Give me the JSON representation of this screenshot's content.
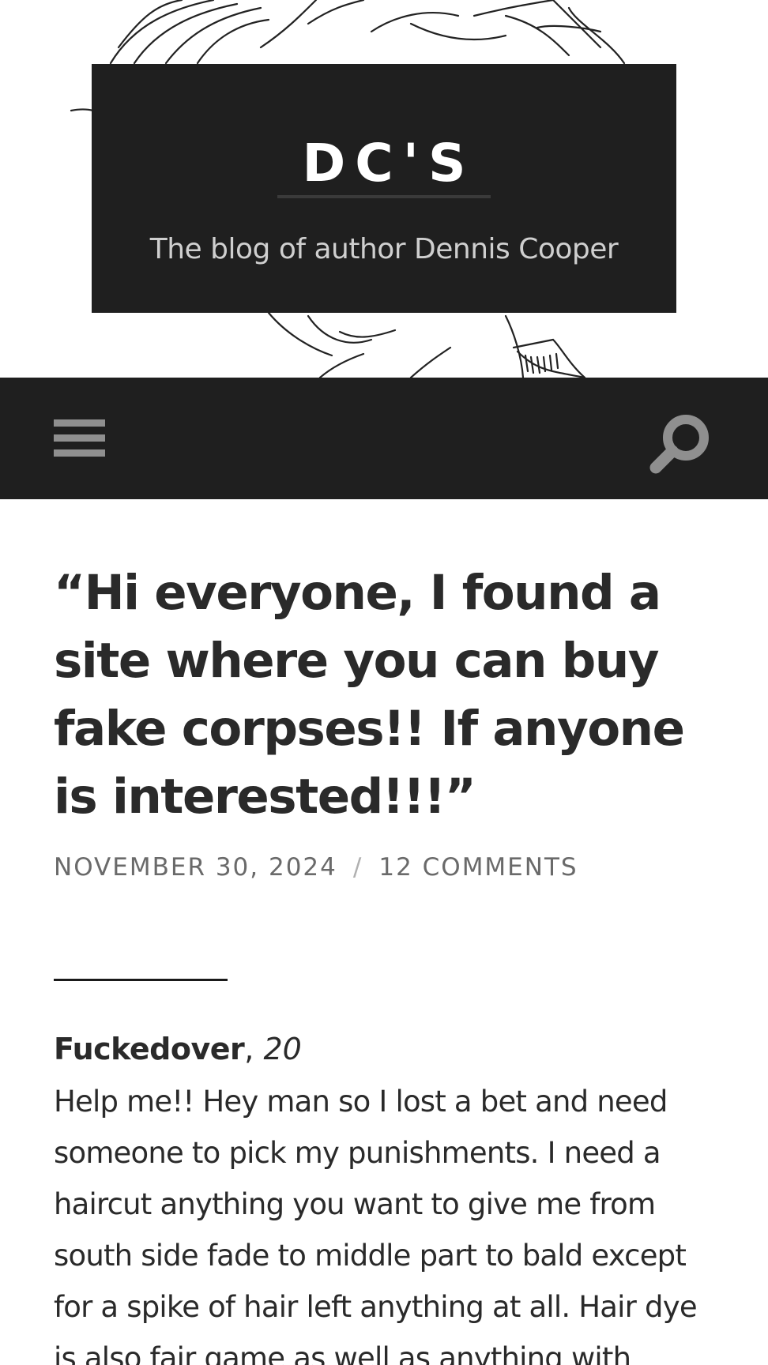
{
  "header": {
    "site_title": "DC'S",
    "tagline": "The blog of author Dennis Cooper"
  },
  "nav": {
    "menu_icon": "hamburger-menu-icon",
    "search_icon": "search-magnifier-icon"
  },
  "post": {
    "title": "“Hi everyone, I found a site where you can buy fake corpses!! If anyone is interested!!!”",
    "date": "NOVEMBER 30, 2024",
    "separator": "/",
    "comments_link": "12 COMMENTS",
    "comment": {
      "author": "Fuckedover",
      "comma": ",",
      "age": "20",
      "text": "Help me!! Hey man so I lost a bet and need someone to pick my punishments. I need a haircut anything you want to give me from south side fade to middle part to bald except for a spike of hair left anything at all. Hair dye is also fair game as well as anything with"
    }
  },
  "colors": {
    "dark_bar": "#1f1f1f",
    "icon_gray": "#8f8f8f",
    "meta_gray": "#6a6a6a",
    "text": "#2a2a2a"
  }
}
